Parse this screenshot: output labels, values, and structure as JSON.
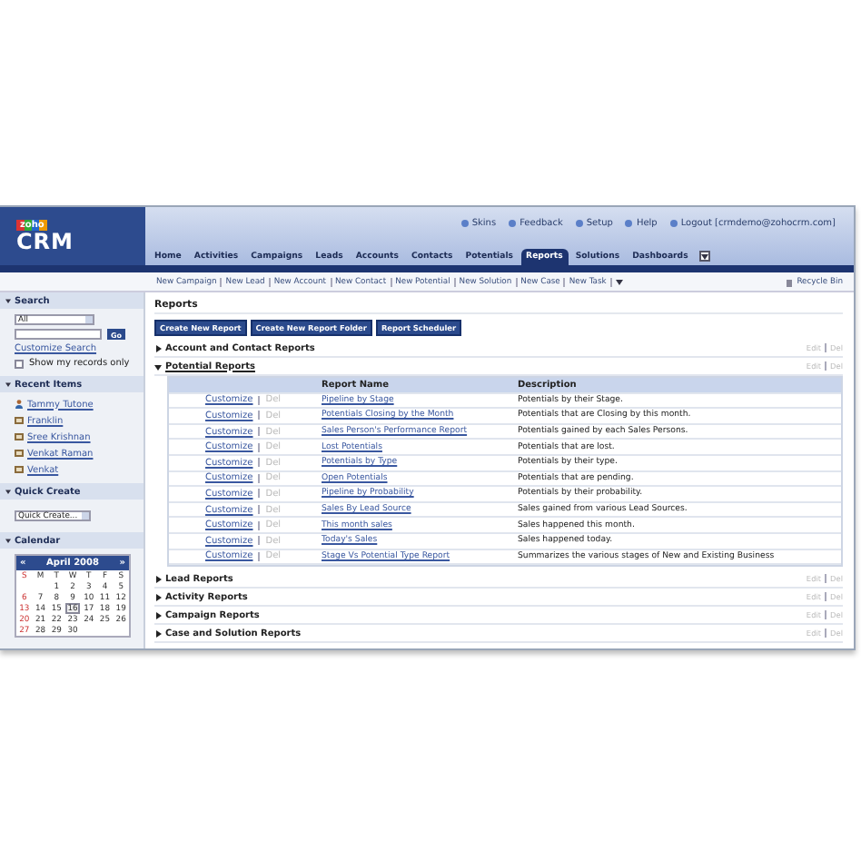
{
  "logo": {
    "badge": "zoho",
    "name": "CRM"
  },
  "top_links": [
    {
      "label": "Skins"
    },
    {
      "label": "Feedback"
    },
    {
      "label": "Setup"
    },
    {
      "label": "Help"
    },
    {
      "label": "Logout [crmdemo@zohocrm.com]"
    }
  ],
  "tabs": [
    {
      "label": "Home",
      "selected": false
    },
    {
      "label": "Activities",
      "selected": false
    },
    {
      "label": "Campaigns",
      "selected": false
    },
    {
      "label": "Leads",
      "selected": false
    },
    {
      "label": "Accounts",
      "selected": false
    },
    {
      "label": "Contacts",
      "selected": false
    },
    {
      "label": "Potentials",
      "selected": false
    },
    {
      "label": "Reports",
      "selected": true
    },
    {
      "label": "Solutions",
      "selected": false
    },
    {
      "label": "Dashboards",
      "selected": false
    }
  ],
  "quick_links": [
    "New Campaign",
    "New Lead",
    "New Account",
    "New Contact",
    "New Potential",
    "New Solution",
    "New Case",
    "New Task"
  ],
  "recycle_bin": "Recycle Bin",
  "sidebar": {
    "search": {
      "title": "Search",
      "module": "All",
      "go": "Go",
      "customize": "Customize Search",
      "my_records": {
        "label": "Show my records only",
        "checked": false
      }
    },
    "recent": {
      "title": "Recent Items",
      "items": [
        {
          "label": "Tammy Tutone",
          "kind": "person"
        },
        {
          "label": "Franklin",
          "kind": "card"
        },
        {
          "label": "Sree Krishnan",
          "kind": "card"
        },
        {
          "label": "Venkat Raman",
          "kind": "card"
        },
        {
          "label": "Venkat",
          "kind": "card"
        }
      ]
    },
    "quick_create": {
      "title": "Quick Create",
      "value": "Quick Create..."
    },
    "calendar": {
      "title": "Calendar",
      "month": "April 2008",
      "prev": "«",
      "next": "»",
      "weekdays": [
        "S",
        "M",
        "T",
        "W",
        "T",
        "F",
        "S"
      ],
      "weeks": [
        [
          {
            "d": "1",
            "selected": false
          },
          {
            "d": "2",
            "selected": false
          },
          {
            "d": "3",
            "selected": false
          },
          {
            "d": "4",
            "selected": false
          },
          {
            "d": "5",
            "selected": false
          }
        ],
        [
          {
            "d": "6",
            "selected": false
          },
          {
            "d": "7",
            "selected": false
          },
          {
            "d": "8",
            "selected": false
          },
          {
            "d": "9",
            "selected": false
          },
          {
            "d": "10",
            "selected": false
          },
          {
            "d": "11",
            "selected": false
          },
          {
            "d": "12",
            "selected": false
          }
        ],
        [
          {
            "d": "13",
            "selected": false
          },
          {
            "d": "14",
            "selected": false
          },
          {
            "d": "15",
            "selected": false
          },
          {
            "d": "16",
            "selected": true
          },
          {
            "d": "17",
            "selected": false
          },
          {
            "d": "18",
            "selected": false
          },
          {
            "d": "19",
            "selected": false
          }
        ],
        [
          {
            "d": "20",
            "selected": false
          },
          {
            "d": "21",
            "selected": false
          },
          {
            "d": "22",
            "selected": false
          },
          {
            "d": "23",
            "selected": false
          },
          {
            "d": "24",
            "selected": false
          },
          {
            "d": "25",
            "selected": false
          },
          {
            "d": "26",
            "selected": false
          }
        ],
        [
          {
            "d": "27",
            "selected": false
          },
          {
            "d": "28",
            "selected": false
          },
          {
            "d": "29",
            "selected": false
          },
          {
            "d": "30",
            "selected": false
          }
        ]
      ]
    }
  },
  "main": {
    "title": "Reports",
    "buttons": [
      "Create New Report",
      "Create New Report Folder",
      "Report Scheduler"
    ],
    "sections": [
      {
        "title": "Account and Contact Reports",
        "expanded": false,
        "actions": [
          "Edit",
          "Del"
        ]
      },
      {
        "title": "Potential Reports",
        "expanded": true,
        "actions": [
          "Edit",
          "Del"
        ],
        "table": {
          "columns": [
            "Report Name",
            "Description"
          ],
          "rows": [
            {
              "customize": "Customize",
              "del": "Del",
              "name": "Pipeline by Stage",
              "description": "Potentials by their Stage."
            },
            {
              "customize": "Customize",
              "del": "Del",
              "name": "Potentials Closing by the Month",
              "description": "Potentials that are Closing by this month."
            },
            {
              "customize": "Customize",
              "del": "Del",
              "name": "Sales Person's Performance Report",
              "description": "Potentials gained by each Sales Persons."
            },
            {
              "customize": "Customize",
              "del": "Del",
              "name": "Lost Potentials",
              "description": "Potentials that are lost."
            },
            {
              "customize": "Customize",
              "del": "Del",
              "name": "Potentials by Type",
              "description": "Potentials by their type."
            },
            {
              "customize": "Customize",
              "del": "Del",
              "name": "Open Potentials",
              "description": "Potentials that are pending."
            },
            {
              "customize": "Customize",
              "del": "Del",
              "name": "Pipeline by Probability",
              "description": "Potentials by their probability."
            },
            {
              "customize": "Customize",
              "del": "Del",
              "name": "Sales By Lead Source",
              "description": "Sales gained from various Lead Sources."
            },
            {
              "customize": "Customize",
              "del": "Del",
              "name": "This month sales",
              "description": "Sales happened this month."
            },
            {
              "customize": "Customize",
              "del": "Del",
              "name": "Today's Sales",
              "description": "Sales happened today."
            },
            {
              "customize": "Customize",
              "del": "Del",
              "name": "Stage Vs Potential Type Report",
              "description": "Summarizes the various stages of New and Existing Business"
            }
          ]
        }
      },
      {
        "title": "Lead Reports",
        "expanded": false,
        "actions": [
          "Edit",
          "Del"
        ]
      },
      {
        "title": "Activity Reports",
        "expanded": false,
        "actions": [
          "Edit",
          "Del"
        ]
      },
      {
        "title": "Campaign Reports",
        "expanded": false,
        "actions": [
          "Edit",
          "Del"
        ]
      },
      {
        "title": "Case and Solution Reports",
        "expanded": false,
        "actions": [
          "Edit",
          "Del"
        ]
      }
    ]
  }
}
